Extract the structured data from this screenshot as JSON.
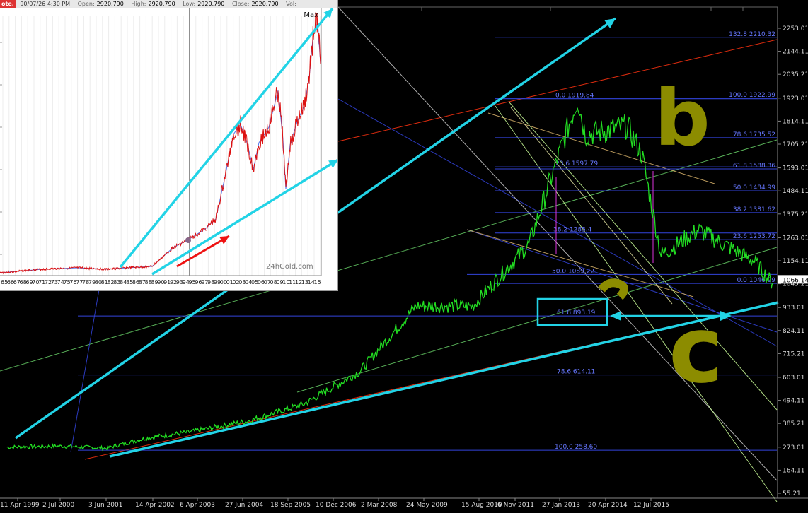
{
  "inset": {
    "header": {
      "button": "ote.",
      "datetime": "90/07/26 4:30 PM",
      "open_label": "Open:",
      "open_value": "2920.790",
      "high_label": "High:",
      "high_value": "2920.790",
      "low_label": "Low:",
      "low_value": "2920.790",
      "close_label": "Close:",
      "close_value": "2920.790",
      "vol_label": "Vol:"
    },
    "max_label": "Max",
    "brand": "24hGold.com",
    "x_ticks": [
      "65",
      "66",
      "67",
      "68",
      "69",
      "70",
      "71",
      "72",
      "73",
      "74",
      "75",
      "76",
      "77",
      "78",
      "79",
      "80",
      "81",
      "82",
      "83",
      "84",
      "85",
      "86",
      "87",
      "88",
      "89",
      "90",
      "91",
      "92",
      "93",
      "94",
      "95",
      "96",
      "97",
      "98",
      "99",
      "00",
      "01",
      "02",
      "03",
      "04",
      "05",
      "06",
      "07",
      "08",
      "09",
      "10",
      "11",
      "12",
      "13",
      "14",
      "15"
    ]
  },
  "chart_data": {
    "type": "line",
    "series": [
      {
        "color": "#22dd22",
        "x": [
          "1999-04-11",
          "2000-07-02",
          "2001-06-03",
          "2002-04-14",
          "2003-04-06",
          "2004-06-27",
          "2005-09-18",
          "2006-12-10",
          "2008-03-02",
          "2009-05-24",
          "2010-08-15",
          "2011-09-06",
          "2011-11-06",
          "2012-10-01",
          "2013-01-27",
          "2013-06-30",
          "2014-04-20",
          "2015-07-12",
          "2015-11-30"
        ],
        "values": [
          273,
          278,
          268,
          315,
          345,
          395,
          475,
          630,
          940,
          940,
          1230,
          1919.84,
          1750,
          1790,
          1660,
          1180,
          1300,
          1150,
          1046.99
        ]
      }
    ],
    "x_ticks": [
      "11 Apr 1999",
      "2 Jul 2000",
      "3 Jun 2001",
      "14 Apr 2002",
      "6 Apr 2003",
      "27 Jun 2004",
      "18 Sep 2005",
      "10 Dec 2006",
      "2 Mar 2008",
      "24 May 2009",
      "15 Aug 2010",
      "6 Nov 2011",
      "27 Jan 2013",
      "20 Apr 2014",
      "12 Jul 2015"
    ],
    "y_ticks": [
      "2253.01",
      "2144.11",
      "2035.21",
      "1923.01",
      "1814.11",
      "1705.21",
      "1593.01",
      "1484.11",
      "1375.21",
      "1263.01",
      "1154.11",
      "1045.21",
      "933.01",
      "824.11",
      "715.21",
      "603.01",
      "494.11",
      "385.21",
      "273.01",
      "164.11",
      "55.21"
    ],
    "current_price": "1066.14",
    "ylim": [
      55.21,
      2253.01
    ],
    "fib_left": [
      {
        "label": "0.0",
        "value": "1919.84"
      },
      {
        "label": "23.6",
        "value": "1597.79"
      },
      {
        "label": "38.2",
        "value": "1285.4"
      },
      {
        "label": "50.0",
        "value": "1089.22"
      },
      {
        "label": "61.8",
        "value": "893.19"
      },
      {
        "label": "78.6",
        "value": "614.11"
      },
      {
        "label": "100.0",
        "value": "258.60"
      }
    ],
    "fib_right": [
      {
        "label": "132.8",
        "value": "2210.32"
      },
      {
        "label": "100.0",
        "value": "1922.99"
      },
      {
        "label": "78.6",
        "value": "1735.52"
      },
      {
        "label": "61.8",
        "value": "1588.36"
      },
      {
        "label": "50.0",
        "value": "1484.99"
      },
      {
        "label": "38.2",
        "value": "1381.62"
      },
      {
        "label": "23.6",
        "value": "1253.72"
      },
      {
        "label": "0.0",
        "value": "1046.99"
      }
    ],
    "wave_labels": [
      "b",
      "c"
    ],
    "grid": false,
    "colors": {
      "background": "#000000",
      "price": "#22dd22",
      "fib": "#4455ff",
      "annotation": "#22d3e6",
      "wave_label": "#8c8c00"
    }
  }
}
